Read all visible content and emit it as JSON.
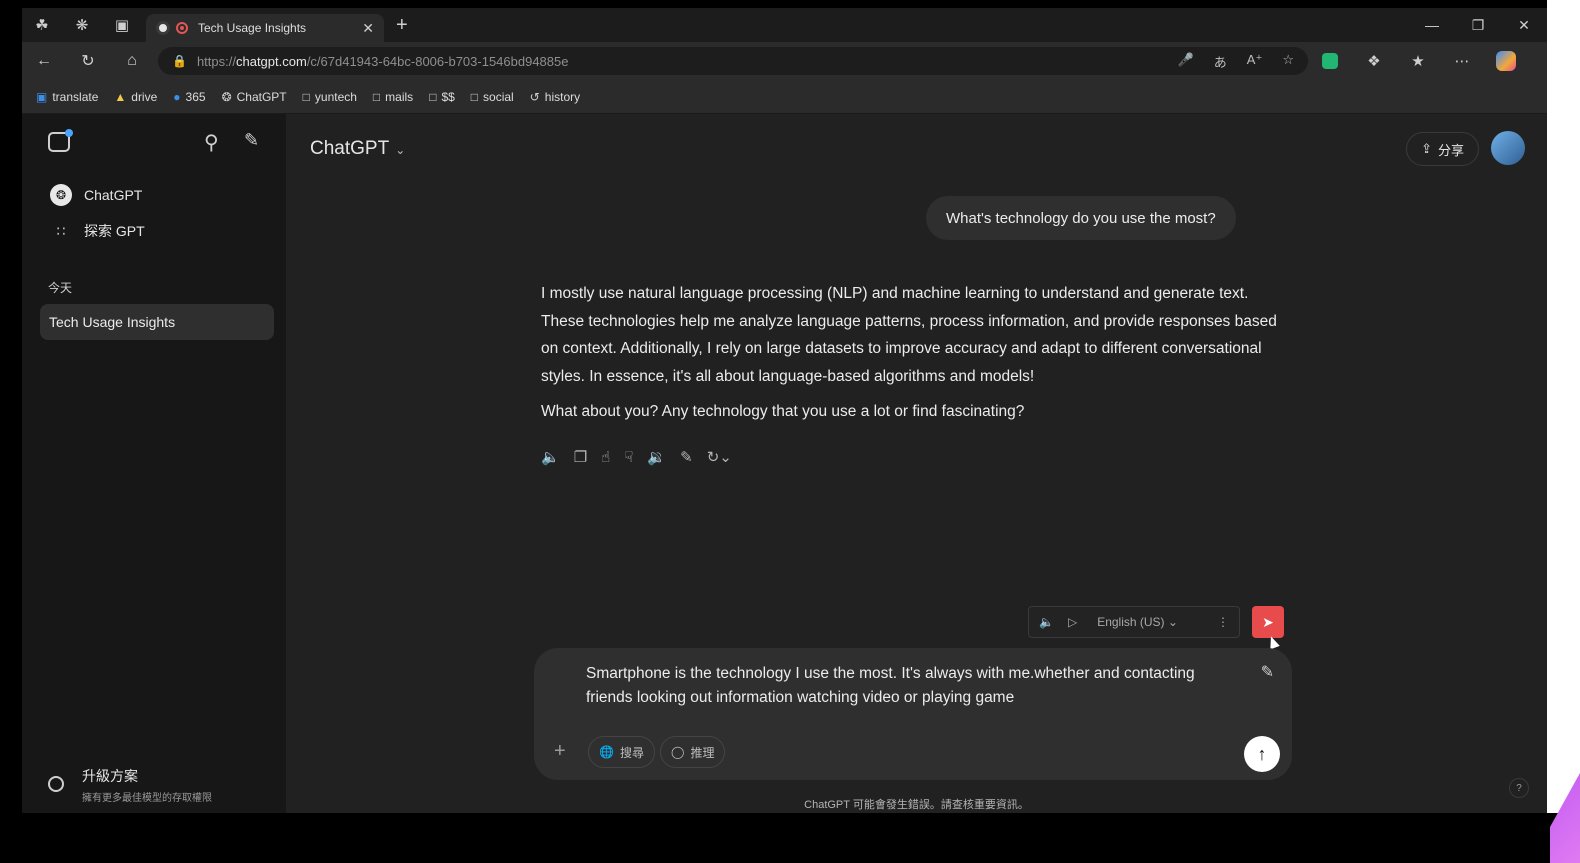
{
  "browser": {
    "tab_title": "Tech Usage Insights",
    "url_prefix": "https://",
    "url_host": "chatgpt.com",
    "url_path": "/c/67d41943-64bc-8006-b703-1546bd94885e"
  },
  "bookmarks": [
    {
      "label": "translate",
      "icon": "translate-icon"
    },
    {
      "label": "drive",
      "icon": "drive-icon"
    },
    {
      "label": "365",
      "icon": "m365-icon"
    },
    {
      "label": "ChatGPT",
      "icon": "chatgpt-icon"
    },
    {
      "label": "yuntech",
      "icon": "folder-icon"
    },
    {
      "label": "mails",
      "icon": "folder-icon"
    },
    {
      "label": "$$",
      "icon": "folder-icon"
    },
    {
      "label": "social",
      "icon": "folder-icon"
    },
    {
      "label": "history",
      "icon": "history-icon"
    }
  ],
  "sidebar": {
    "items": [
      {
        "label": "ChatGPT",
        "icon": "chatgpt-icon"
      },
      {
        "label": "探索 GPT",
        "icon": "grid-icon"
      }
    ],
    "section_today": "今天",
    "chats": [
      {
        "label": "Tech Usage Insights"
      }
    ],
    "upgrade_title": "升級方案",
    "upgrade_subtitle": "擁有更多最佳模型的存取權限"
  },
  "header": {
    "model": "ChatGPT",
    "share_label": "分享"
  },
  "conversation": {
    "user_message": "What's technology do you use the most?",
    "assistant_p1": "I mostly use natural language processing (NLP) and machine learning to understand and generate text. These technologies help me analyze language patterns, process information, and provide responses based on context. Additionally, I rely on large datasets to improve accuracy and adapt to different conversational styles. In essence, it's all about language-based algorithms and models!",
    "assistant_p2": "What about you? Any technology that you use a lot or find fascinating?"
  },
  "voice_toolbar": {
    "language": "English (US)"
  },
  "composer": {
    "text": "Smartphone is the technology I use the most. It's always with me.whether and contacting friends looking out information watching video or playing game",
    "search_label": "搜尋",
    "reason_label": "推理"
  },
  "footer": {
    "disclaimer": "ChatGPT 可能會發生錯誤。請查核重要資訊。",
    "help": "?"
  },
  "colors": {
    "background": "#212121",
    "sidebar": "#171717",
    "bubble": "#2f2f2f",
    "send_red": "#e84b4b"
  }
}
